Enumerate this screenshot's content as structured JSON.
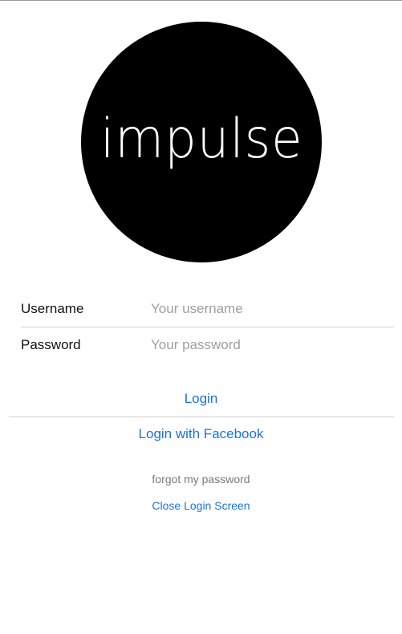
{
  "logo": {
    "text": "impulse"
  },
  "form": {
    "username": {
      "label": "Username",
      "placeholder": "Your username",
      "value": ""
    },
    "password": {
      "label": "Password",
      "placeholder": "Your password",
      "value": ""
    }
  },
  "actions": {
    "login_label": "Login",
    "facebook_label": "Login with Facebook",
    "forgot_label": "forgot my password",
    "close_label": "Close Login Screen"
  },
  "colors": {
    "accent": "#1a73e0",
    "logo_bg": "#000000",
    "logo_text": "#ffffff",
    "placeholder": "#9e9e9e",
    "muted_link": "#7a7a7a",
    "divider": "#cfcfcf"
  }
}
